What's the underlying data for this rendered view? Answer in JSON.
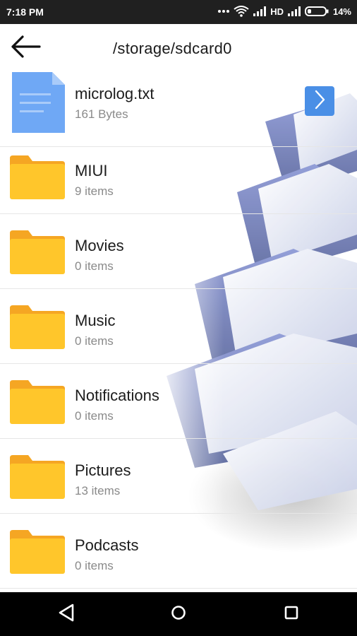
{
  "status_bar": {
    "time": "7:18 PM",
    "network_label": "HD",
    "battery": "14%",
    "icons": [
      "more-dots-icon",
      "wifi-icon",
      "signal-icon",
      "signal-icon",
      "battery-icon"
    ]
  },
  "app_bar": {
    "back_icon": "arrow-left-icon",
    "path": "/storage/sdcard0"
  },
  "files": [
    {
      "name": "microlog.txt",
      "meta": "161 Bytes",
      "type": "file",
      "icon": "document-icon"
    },
    {
      "name": "MIUI",
      "meta": "9 items",
      "type": "folder",
      "icon": "folder-icon"
    },
    {
      "name": "Movies",
      "meta": "0 items",
      "type": "folder",
      "icon": "folder-icon"
    },
    {
      "name": "Music",
      "meta": "0 items",
      "type": "folder",
      "icon": "folder-icon"
    },
    {
      "name": "Notifications",
      "meta": "0 items",
      "type": "folder",
      "icon": "folder-icon"
    },
    {
      "name": "Pictures",
      "meta": "13 items",
      "type": "folder",
      "icon": "folder-icon"
    },
    {
      "name": "Podcasts",
      "meta": "0 items",
      "type": "folder",
      "icon": "folder-icon"
    }
  ],
  "open_button_icon": "chevron-right-icon",
  "nav_bar": {
    "icons": [
      "back-triangle-icon",
      "home-circle-icon",
      "recents-square-icon"
    ]
  },
  "colors": {
    "folder": "#FFC62B",
    "folder_tab": "#F5A623",
    "document": "#6FA8F5",
    "accent": "#4A8FE6",
    "status_bar": "#202020",
    "nav_bar": "#000000"
  }
}
